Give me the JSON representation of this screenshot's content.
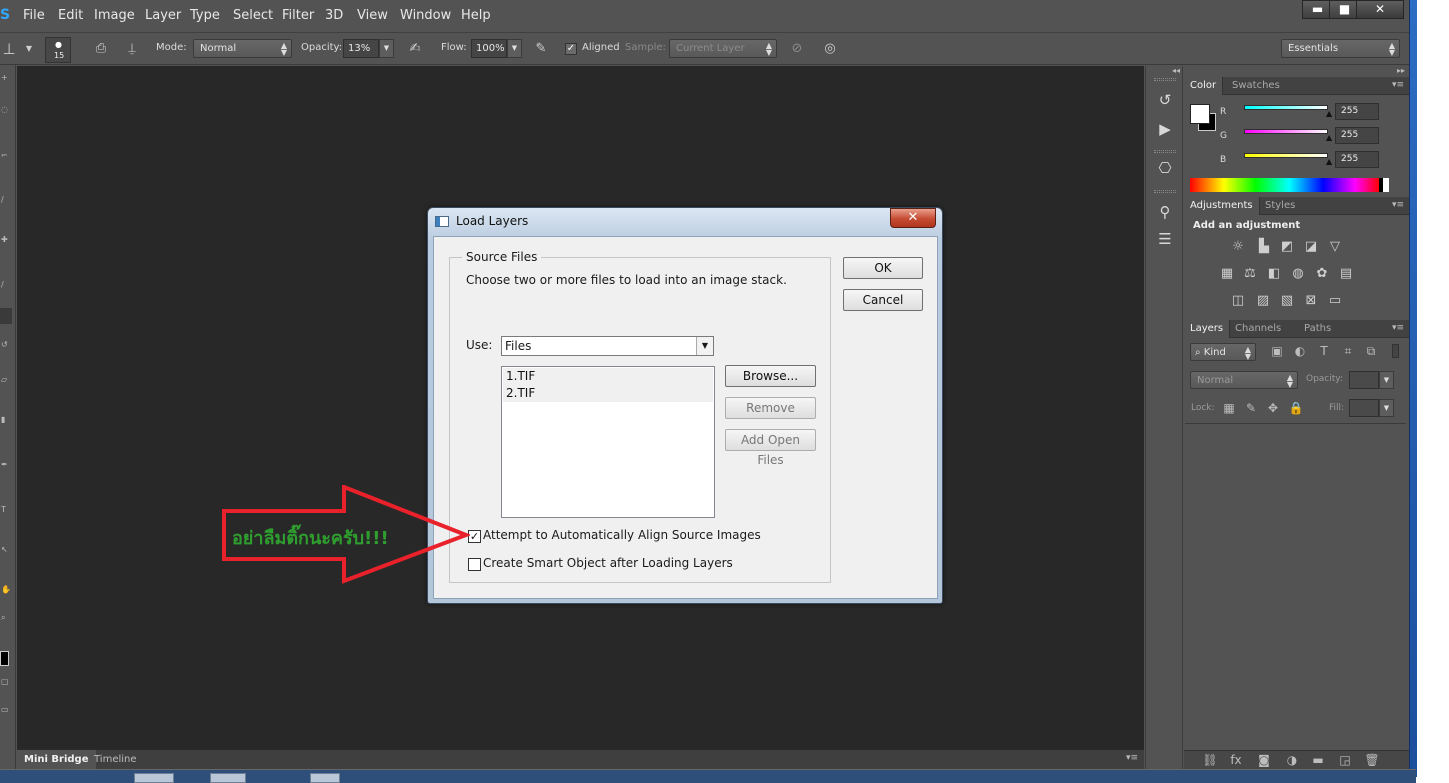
{
  "menubar": {
    "app_logo": "S",
    "items": [
      "File",
      "Edit",
      "Image",
      "Layer",
      "Type",
      "Select",
      "Filter",
      "3D",
      "View",
      "Window",
      "Help"
    ]
  },
  "window_controls": {
    "minimize": "▬",
    "maximize": "■",
    "close": "✕"
  },
  "options_bar": {
    "brush_size": "15",
    "mode_label": "Mode:",
    "mode_value": "Normal",
    "opacity_label": "Opacity:",
    "opacity_value": "13%",
    "flow_label": "Flow:",
    "flow_value": "100%",
    "aligned_label": "Aligned",
    "aligned_checked": true,
    "sample_label": "Sample:",
    "sample_value": "Current Layer",
    "workspace": "Essentials"
  },
  "bottom_tabs": [
    "Mini Bridge",
    "Timeline"
  ],
  "color_panel": {
    "tabs": [
      "Color",
      "Swatches"
    ],
    "channels": [
      {
        "label": "R",
        "value": "255",
        "color": "#00ffff"
      },
      {
        "label": "G",
        "value": "255",
        "color": "#ff00ff"
      },
      {
        "label": "B",
        "value": "255",
        "color": "#ffff00"
      }
    ]
  },
  "adjustments_panel": {
    "tabs": [
      "Adjustments",
      "Styles"
    ],
    "heading": "Add an adjustment"
  },
  "layers_panel": {
    "tabs": [
      "Layers",
      "Channels",
      "Paths"
    ],
    "filter_kind": "Kind",
    "blend_mode": "Normal",
    "opacity_label": "Opacity:",
    "lock_label": "Lock:",
    "fill_label": "Fill:"
  },
  "dialog": {
    "title": "Load Layers",
    "close_glyph": "✕",
    "group_title": "Source Files",
    "instructions": "Choose two or more files to load into an image stack.",
    "use_label": "Use:",
    "use_value": "Files",
    "files": [
      "1.TIF",
      "2.TIF"
    ],
    "buttons": {
      "ok": "OK",
      "cancel": "Cancel",
      "browse": "Browse...",
      "remove": "Remove",
      "add_open_files": "Add Open Files"
    },
    "align_label": "Attempt to Automatically Align Source Images",
    "align_checked": true,
    "smart_object_label": "Create Smart Object after Loading Layers",
    "smart_object_checked": false
  },
  "annotation": {
    "text": "อย่าลืมติ๊กนะครับ!!!",
    "arrow_color": "#e8212a",
    "text_color": "#2e9e2e"
  }
}
